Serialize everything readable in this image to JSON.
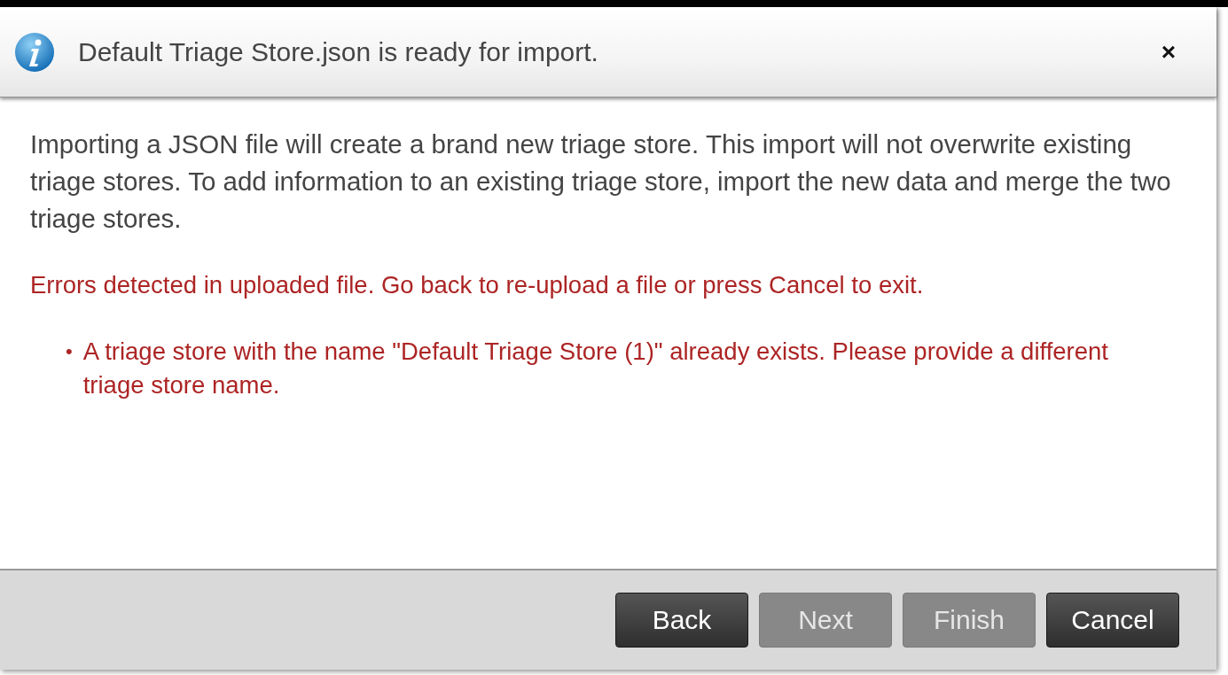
{
  "dialog": {
    "message": "Default Triage Store.json is ready for import.",
    "close": "×",
    "description": "Importing a JSON file will create a brand new triage store. This import will not overwrite existing triage stores. To add information to an existing triage store, import the new data and merge the two triage stores.",
    "error": "Errors detected in uploaded file. Go back to re-upload a file or press Cancel to exit.",
    "error_items": [
      {
        "marker": "•",
        "text": "A triage store with the name \"Default Triage Store (1)\" already exists. Please provide a different triage store name."
      }
    ],
    "buttons": [
      {
        "label": "Back",
        "disabled": false
      },
      {
        "label": "Next",
        "disabled": true
      },
      {
        "label": "Finish",
        "disabled": true
      },
      {
        "label": "Cancel",
        "disabled": false
      }
    ]
  }
}
